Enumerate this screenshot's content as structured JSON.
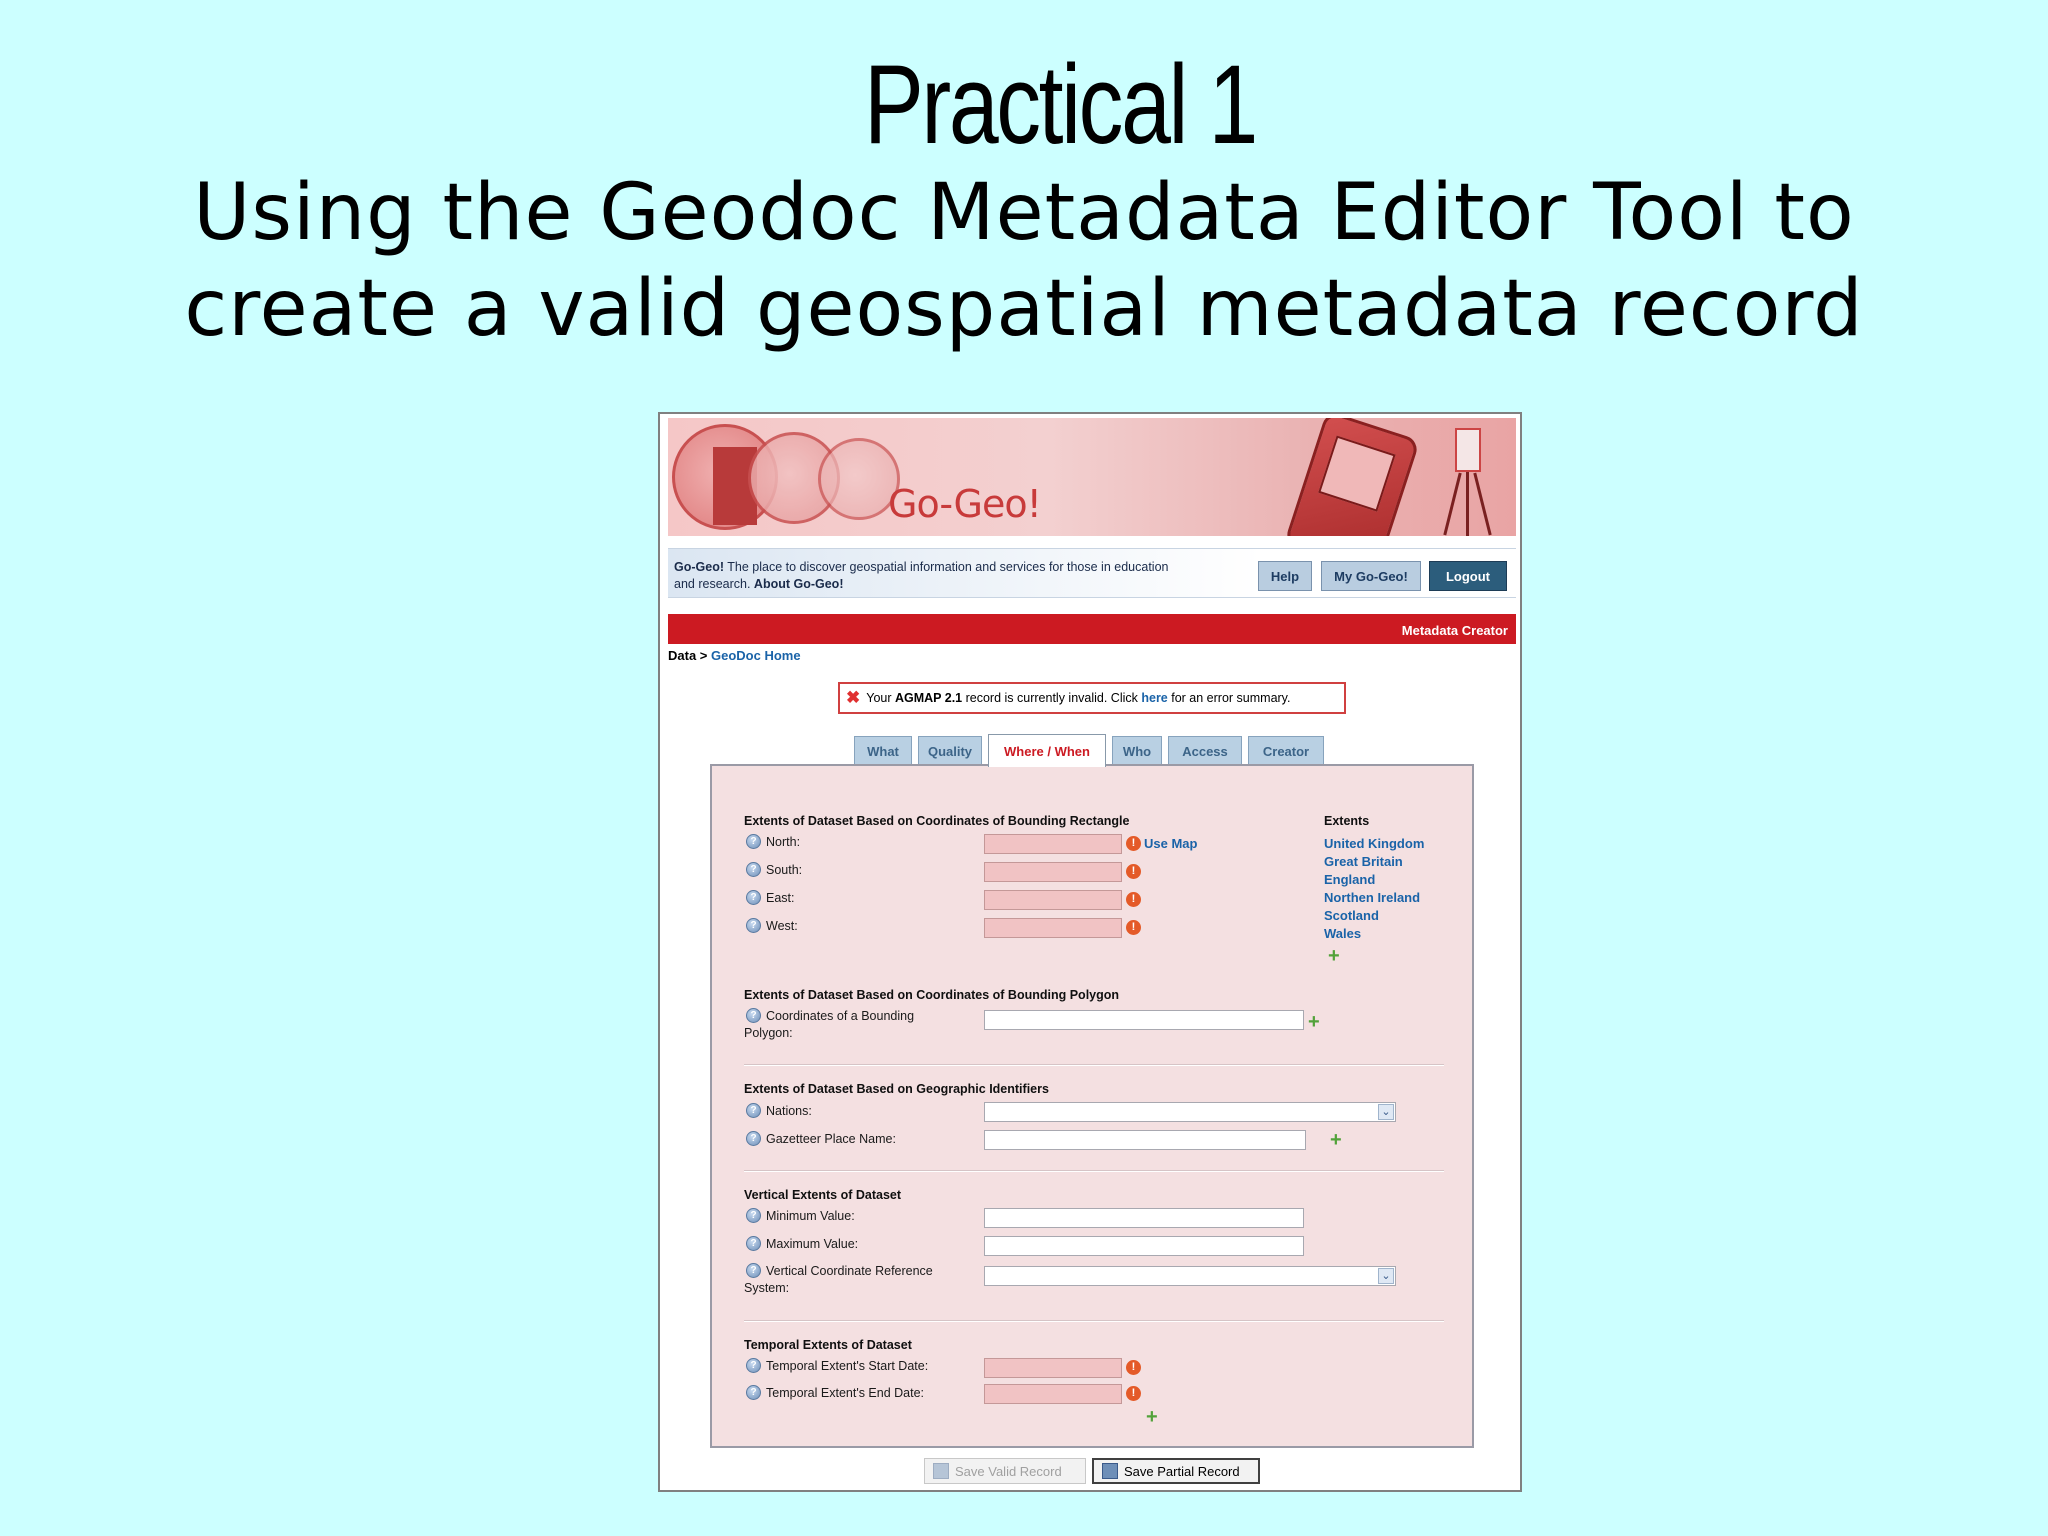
{
  "slide": {
    "title": "Practical 1",
    "subtitle_line1": "Using the Geodoc Metadata Editor Tool to",
    "subtitle_line2": "create a valid geospatial metadata record"
  },
  "app": {
    "brand": "Go-Geo!",
    "info_brand": "Go-Geo!",
    "info_text": " The place to discover geospatial information and services for those in education and research. ",
    "about_link": "About Go-Geo!",
    "nav": {
      "help": "Help",
      "my_go_geo": "My Go-Geo!",
      "logout": "Logout"
    },
    "redbar_label": "Metadata Creator",
    "breadcrumb": {
      "root": "Data",
      "sep": " > ",
      "current": "GeoDoc Home"
    },
    "error": {
      "pre": "Your ",
      "schema": "AGMAP 2.1",
      "mid": " record is currently invalid. Click ",
      "link": "here",
      "post": " for an error summary."
    },
    "tabs": [
      "What",
      "Quality",
      "Where / When",
      "Who",
      "Access",
      "Creator"
    ],
    "active_tab": "Where / When",
    "bounding_rect": {
      "title": "Extents of Dataset Based on Coordinates of Bounding Rectangle",
      "north": "North:",
      "south": "South:",
      "east": "East:",
      "west": "West:",
      "use_map": "Use Map"
    },
    "extents": {
      "title": "Extents",
      "items": [
        "United Kingdom",
        "Great Britain",
        "England",
        "Northen Ireland",
        "Scotland",
        "Wales"
      ]
    },
    "bounding_polygon": {
      "title": "Extents of Dataset Based on Coordinates of Bounding Polygon",
      "coords_line1": "Coordinates of a Bounding",
      "coords_line2": "Polygon:"
    },
    "geo_ids": {
      "title": "Extents of Dataset Based on Geographic Identifiers",
      "nations": "Nations:",
      "gazetteer": "Gazetteer Place Name:"
    },
    "vertical": {
      "title": "Vertical Extents of Dataset",
      "min": "Minimum Value:",
      "max": "Maximum Value:",
      "crs_line1": "Vertical Coordinate Reference",
      "crs_line2": "System:"
    },
    "temporal": {
      "title": "Temporal Extents of Dataset",
      "start": "Temporal Extent's Start Date:",
      "end": "Temporal Extent's End Date:"
    },
    "buttons": {
      "save_valid": "Save Valid Record",
      "save_partial": "Save Partial Record"
    },
    "colors": {
      "accent_red": "#cc1a22",
      "link_blue": "#1a63a8",
      "panel_bg": "#f4e0e1",
      "invalid_field": "#f1c3c4"
    }
  }
}
